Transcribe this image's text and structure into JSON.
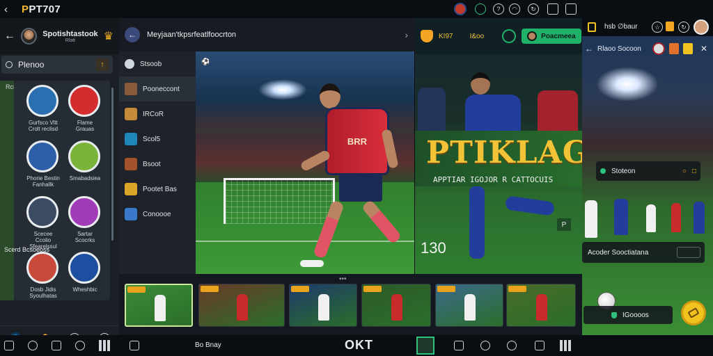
{
  "topbar": {
    "title_prefix": "P",
    "title_rest": "PT707"
  },
  "left_panel": {
    "header_title": "Spotishtastook",
    "header_sub": "Rlatt",
    "search_value": "Plenoo",
    "section_label": "Rcuanra",
    "grid_items": [
      {
        "label": "Gurfsco Vltt Crolt reclisd",
        "color": "#2a6fb0"
      },
      {
        "label": "Flame Grauas",
        "color": "#d32d2d"
      },
      {
        "label": "Phorie Bestin Fanhallk",
        "color": "#2d5fa8"
      },
      {
        "label": "Smabadsiea",
        "color": "#7bb43a"
      },
      {
        "label": "Scecee Ccolio Sfearelssul",
        "color": "#3a4b63"
      },
      {
        "label": "Sartar Scocrks",
        "color": "#a23bb8"
      },
      {
        "label": "Dosb Jidis Syoulhatas",
        "color": "#c94a3a"
      },
      {
        "label": "Wheshbic",
        "color": "#1d4ea0"
      }
    ],
    "grid_section_label": "Scerd Bcsoeoss"
  },
  "mid_header": {
    "title": "Meyjaan'tkpsrfeatlfoocrton"
  },
  "mid_list": [
    {
      "label": "Stsoob",
      "color": "#cfd6dc"
    },
    {
      "label": "Pooneccont",
      "color": "#8b5a3b"
    },
    {
      "label": "IRCoR",
      "color": "#c58a3a"
    },
    {
      "label": "Scol5",
      "color": "#1e88b8"
    },
    {
      "label": "Bsoot",
      "color": "#a0522d"
    },
    {
      "label": "Pootet Bas",
      "color": "#d9a62a"
    },
    {
      "label": "Conoooe",
      "color": "#3a79c9"
    }
  ],
  "hero": {
    "jersey_text": "BRR"
  },
  "promo": {
    "left_label": "KI97",
    "mid_label": "I&oo",
    "button_label": "Poacmeea",
    "big_word": "PTIKLAG",
    "sub_word": "APPTIAR IGOJOR R CATTOCUIS",
    "number": "130",
    "corner_badge": "P"
  },
  "far_panel": {
    "top_right_label": "hsb ∅baur",
    "title": "Rlaoo Socoon",
    "row1_label": "Stoteon",
    "row2_label": "Acoder Sooctiatana",
    "row3_label": "IGoooos"
  },
  "thumbnails": [
    {
      "color": "#3c8a36"
    },
    {
      "color": "#6a3a28"
    },
    {
      "color": "#1e3a6b"
    },
    {
      "color": "#2e5a2a"
    },
    {
      "color": "#3b6a8c"
    },
    {
      "color": "#4a6a2a"
    }
  ],
  "bottom_bar": {
    "center_logo": "OKT",
    "left_label": "Bo Bnay"
  }
}
